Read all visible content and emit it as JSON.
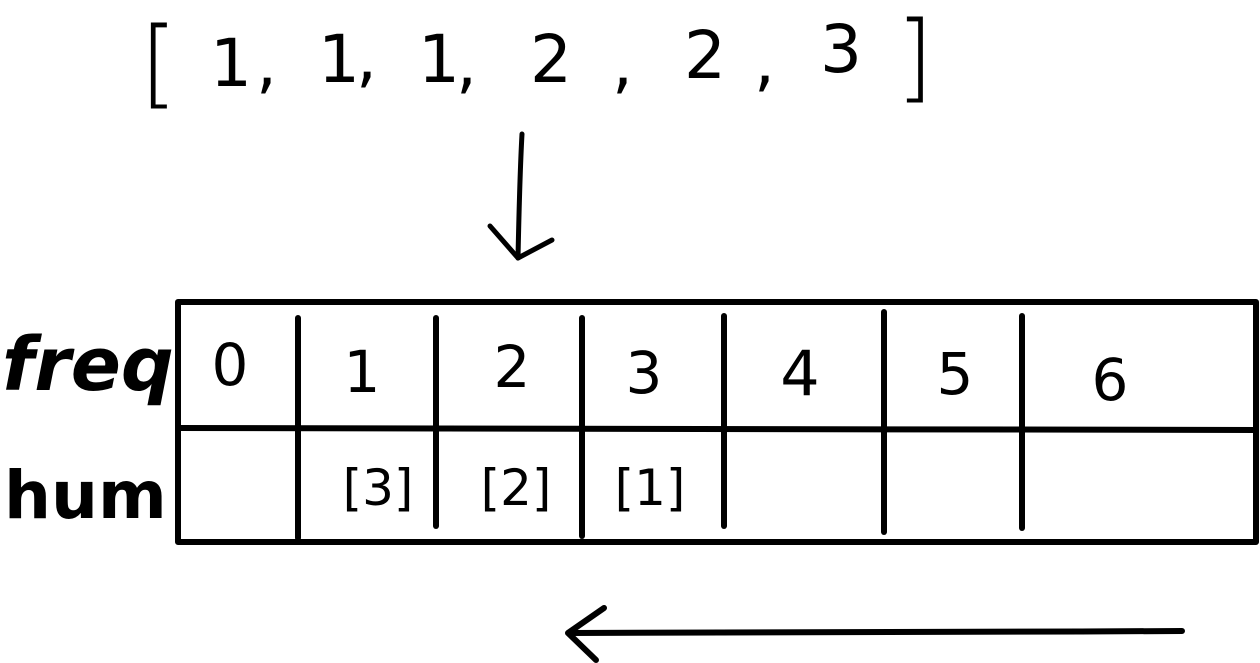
{
  "input_array": {
    "open_bracket": "[",
    "close_bracket": "]",
    "values": [
      "1",
      "1",
      "1",
      "2",
      "2",
      "3"
    ],
    "separator": ","
  },
  "table": {
    "row_labels": {
      "freq": "freq",
      "num": "hum"
    },
    "freq_indices": [
      "0",
      "1",
      "2",
      "3",
      "4",
      "5",
      "6"
    ],
    "num_buckets": [
      "",
      "[3]",
      "[2]",
      "[1]",
      "",
      "",
      ""
    ]
  },
  "colors": {
    "ink": "#000000",
    "background": "#ffffff"
  }
}
